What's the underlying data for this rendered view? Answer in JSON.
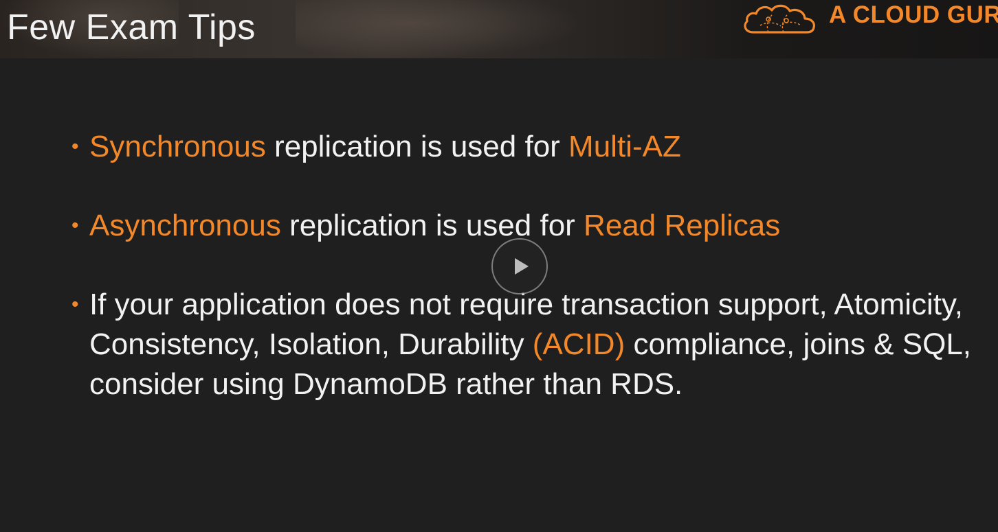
{
  "header": {
    "title": "Few Exam Tips",
    "logo_text": "A CLOUD GUR",
    "logo_icon": "cloud-icon"
  },
  "bullets": [
    {
      "parts": [
        {
          "text": "Synchronous",
          "highlight": true
        },
        {
          "text": " replication is used for ",
          "highlight": false
        },
        {
          "text": "Multi-AZ",
          "highlight": true
        }
      ]
    },
    {
      "parts": [
        {
          "text": "Asynchronous",
          "highlight": true
        },
        {
          "text": " replication is used for ",
          "highlight": false
        },
        {
          "text": "Read Replicas",
          "highlight": true
        }
      ]
    },
    {
      "parts": [
        {
          "text": "If your application does not require transaction support, Atomicity, Consistency, Isolation, Durability ",
          "highlight": false
        },
        {
          "text": "(ACID)",
          "highlight": true
        },
        {
          "text": " compliance, joins & SQL, consider using DynamoDB rather than RDS.",
          "highlight": false
        }
      ]
    }
  ],
  "player": {
    "play_icon": "play-icon"
  },
  "colors": {
    "accent": "#f3882a",
    "text": "#f2f2f2",
    "background": "#1f1f1f"
  }
}
